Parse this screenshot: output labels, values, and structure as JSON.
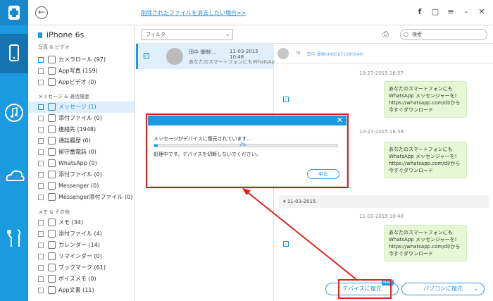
{
  "topbar": {
    "link": "削除されたファイルを消去したい場合>>",
    "icons": [
      "facebook-icon",
      "chat-icon",
      "menu-icon",
      "minimize-icon",
      "close-icon"
    ]
  },
  "device": "iPhone 6s",
  "sections": [
    {
      "title": "写真 & ビデオ",
      "items": [
        {
          "label": "カメラロール (97)",
          "checked": true
        },
        {
          "label": "App写真 (159)",
          "checked": false
        },
        {
          "label": "Appビデオ (0)",
          "checked": false
        }
      ]
    },
    {
      "title": "メッセージ & 通話履歴",
      "items": [
        {
          "label": "メッセージ (1)",
          "checked": true,
          "selected": true
        },
        {
          "label": "添付ファイル (0)",
          "checked": false
        },
        {
          "label": "連絡先 (1948)",
          "checked": false
        },
        {
          "label": "通話履歴 (0)",
          "checked": false
        },
        {
          "label": "留守番電話 (0)",
          "checked": false
        },
        {
          "label": "WhatsApp (0)",
          "checked": false
        },
        {
          "label": "添付ファイル (0)",
          "checked": false
        },
        {
          "label": "Messenger (0)",
          "checked": false
        },
        {
          "label": "Messenger添付ファイル (0)",
          "checked": false
        }
      ]
    },
    {
      "title": "メモ & その他",
      "items": [
        {
          "label": "メモ (34)",
          "checked": false
        },
        {
          "label": "添付ファイル (4)",
          "checked": false
        },
        {
          "label": "カレンダー (14)",
          "checked": false
        },
        {
          "label": "リマインダー (0)",
          "checked": false
        },
        {
          "label": "ブックマーク (61)",
          "checked": false
        },
        {
          "label": "ボイスメモ (0)",
          "checked": false
        },
        {
          "label": "App文書 (11)",
          "checked": false
        }
      ]
    }
  ],
  "filter": {
    "label": "フィルタ"
  },
  "search": {
    "placeholder": "検索"
  },
  "conversation": {
    "name": "田中 優樹(…",
    "date": "11-03-2015 10:48",
    "preview": "あなたのスマートフォンにもWhatsApp…"
  },
  "thread": {
    "to_label": "To:",
    "to_number": "田中 優樹(4495671695944)",
    "messages": [
      {
        "time": "10-27-2015 16:57",
        "text": "あなたのスマートフォンにもWhatsApp メッセンジャーを! https://whatsapp.com/dl/から今すぐダウンロード"
      },
      {
        "time": "10-27-2015 16:58",
        "text": "あなたのスマートフォンにもWhatsApp メッセンジャーを! https://whatsapp.com/dl/から今すぐダウンロード"
      },
      {
        "time": "11-03-2015 10:48",
        "text": "あなたのスマートフォンにもWhatsApp メッセンジャーを! https://whatsapp.com/dl/から今すぐダウンロード"
      }
    ],
    "day_separator": "11-03-2015"
  },
  "buttons": {
    "restore_device": "デバイスに復元",
    "restore_pc": "パソコンに復元",
    "badge": "New"
  },
  "modal": {
    "title": "メッセージがデバイスに復元されています...",
    "progress_percent": 2,
    "progress_label": "2%",
    "note": "処理中です。デバイスを切断しないでください。",
    "cancel": "中止"
  }
}
